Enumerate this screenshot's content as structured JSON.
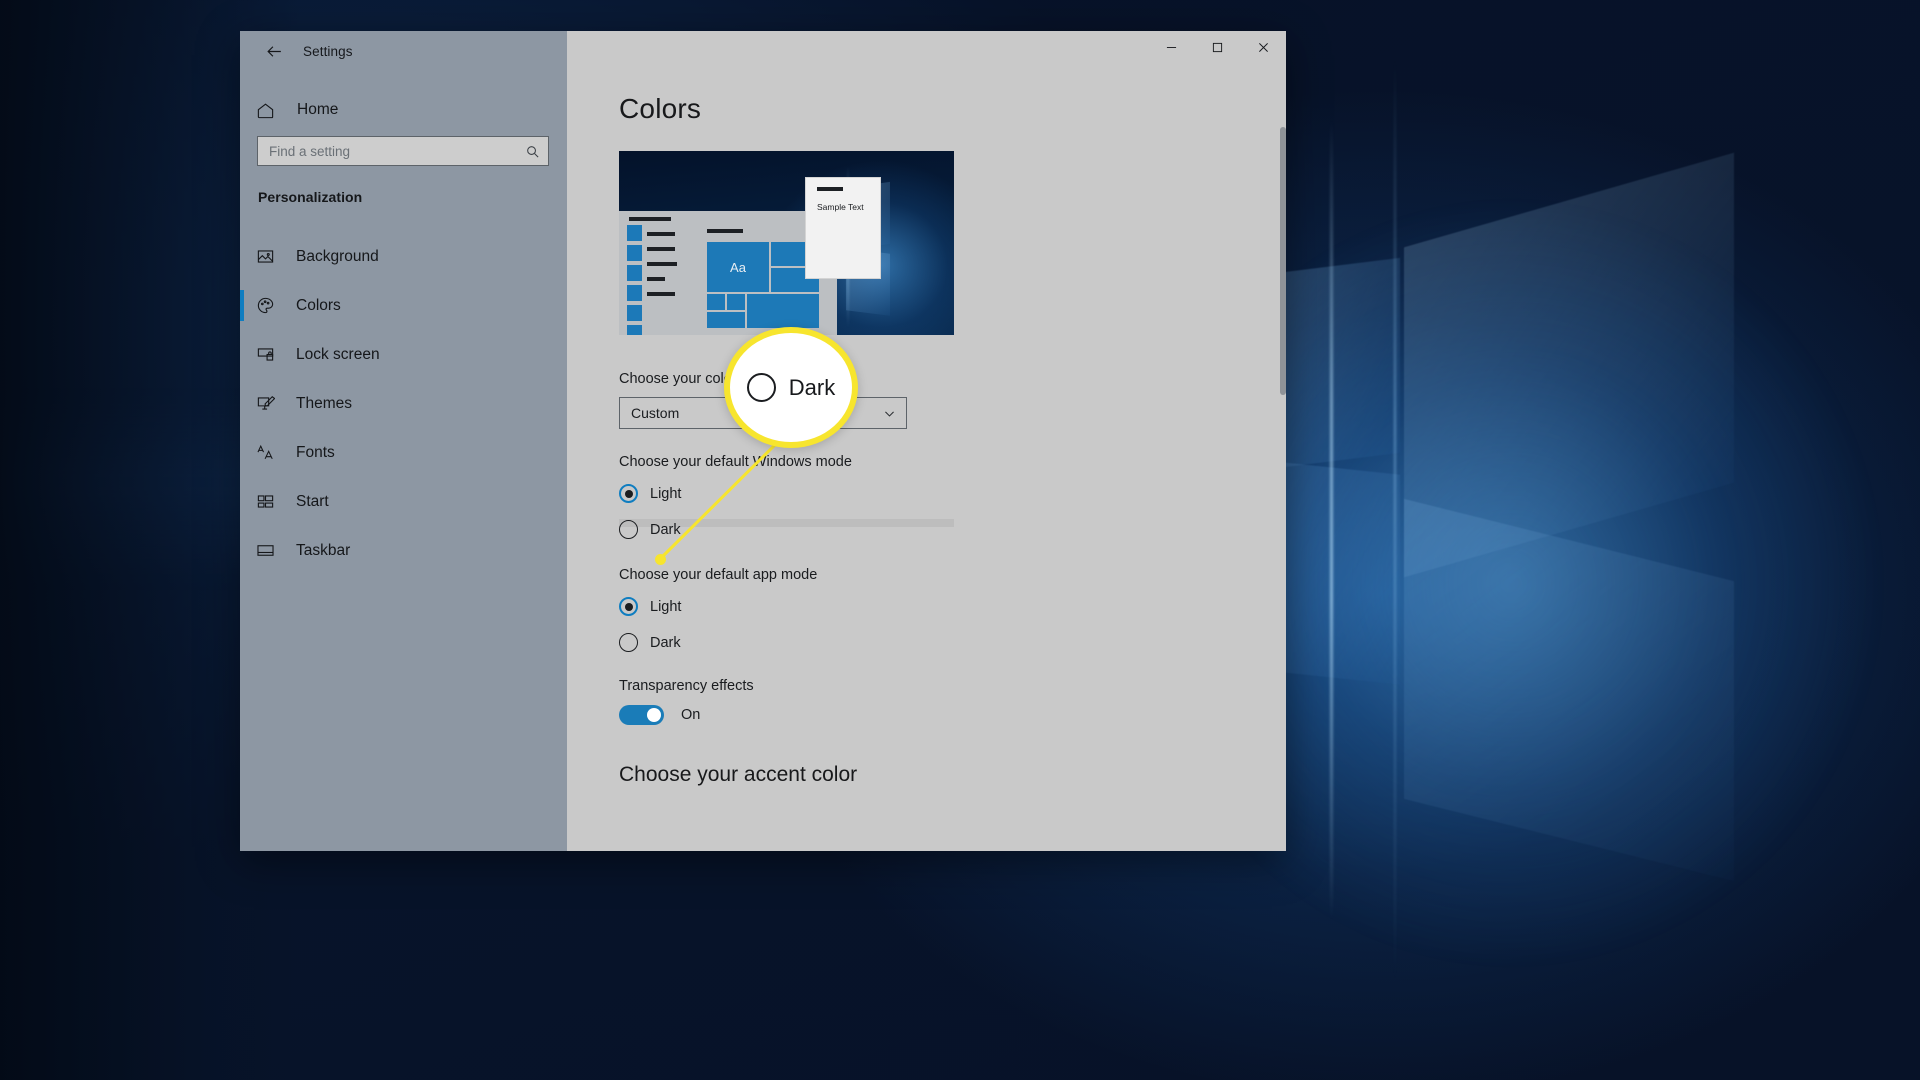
{
  "window": {
    "app_title": "Settings",
    "back_icon": "back-arrow-icon",
    "controls": {
      "minimize": "minimize-icon",
      "maximize": "maximize-icon",
      "close": "close-icon"
    }
  },
  "sidebar": {
    "home_label": "Home",
    "home_icon": "home-icon",
    "search": {
      "placeholder": "Find a setting",
      "value": "",
      "icon": "search-icon"
    },
    "section_label": "Personalization",
    "items": [
      {
        "label": "Background",
        "icon": "image-icon",
        "active": false
      },
      {
        "label": "Colors",
        "icon": "palette-icon",
        "active": true
      },
      {
        "label": "Lock screen",
        "icon": "lock-screen-icon",
        "active": false
      },
      {
        "label": "Themes",
        "icon": "themes-icon",
        "active": false
      },
      {
        "label": "Fonts",
        "icon": "fonts-icon",
        "active": false
      },
      {
        "label": "Start",
        "icon": "start-icon",
        "active": false
      },
      {
        "label": "Taskbar",
        "icon": "taskbar-icon",
        "active": false
      }
    ]
  },
  "main": {
    "page_title": "Colors",
    "preview": {
      "sample_text": "Sample Text",
      "tile_text": "Aa"
    },
    "choose_color": {
      "label": "Choose your color",
      "value": "Custom",
      "chevron_icon": "chevron-down-icon"
    },
    "windows_mode": {
      "label": "Choose your default Windows mode",
      "options": [
        {
          "label": "Light",
          "selected": true
        },
        {
          "label": "Dark",
          "selected": false
        }
      ]
    },
    "app_mode": {
      "label": "Choose your default app mode",
      "options": [
        {
          "label": "Light",
          "selected": true
        },
        {
          "label": "Dark",
          "selected": false
        }
      ]
    },
    "transparency": {
      "label": "Transparency effects",
      "state_label": "On",
      "on": true
    },
    "accent_heading": "Choose your accent color"
  },
  "callout": {
    "magnified_label": "Dark",
    "highlight_color": "#f7e52e"
  },
  "colors": {
    "accent": "#0f7dc0",
    "sidebar_bg": "#8d97a3",
    "content_bg": "#c9c9c9",
    "toggle_on": "#1a7cb8",
    "highlight": "#f7e52e"
  }
}
